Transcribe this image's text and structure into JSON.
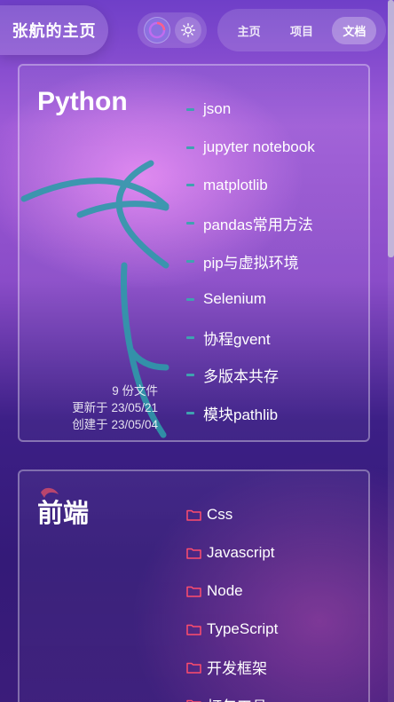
{
  "header": {
    "brand": "张航的主页",
    "nav": [
      {
        "label": "主页",
        "active": false
      },
      {
        "label": "项目",
        "active": false
      },
      {
        "label": "文档",
        "active": true
      }
    ],
    "toggles": [
      {
        "icon": "theme-color-icon",
        "active": true
      },
      {
        "icon": "sun-icon",
        "active": false
      }
    ]
  },
  "sections": [
    {
      "title": "Python",
      "items": [
        "json",
        "jupyter notebook",
        "matplotlib",
        "pandas常用方法",
        "pip与虚拟环境",
        "Selenium",
        "协程gvent",
        "多版本共存",
        "模块pathlib"
      ],
      "meta": {
        "count": "9 份文件",
        "updated": "更新于 23/05/21",
        "created": "创建于 23/05/04"
      }
    },
    {
      "title": "前端",
      "items": [
        "Css",
        "Javascript",
        "Node",
        "TypeScript",
        "开发框架",
        "打包工具"
      ]
    }
  ],
  "colors": {
    "accent": "#3fa2b0",
    "folder": "#ff4d6d"
  }
}
